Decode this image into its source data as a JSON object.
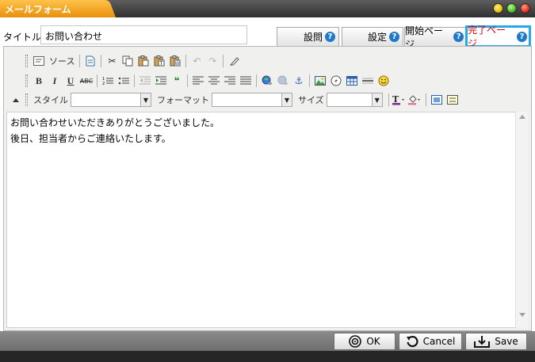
{
  "window": {
    "title": "メールフォーム",
    "controls": [
      "minimize",
      "maximize",
      "close"
    ]
  },
  "form": {
    "title_label": "タイトル:",
    "title_value": "お問い合わせ"
  },
  "tabs": [
    {
      "label": "設問",
      "active": false
    },
    {
      "label": "設定",
      "active": false
    },
    {
      "label": "開始ページ",
      "active": false
    },
    {
      "label": "完了ページ",
      "active": true
    }
  ],
  "help_glyph": "?",
  "toolbar": {
    "source_label": "ソース",
    "style_label": "スタイル",
    "format_label": "フォーマット",
    "size_label": "サイズ",
    "style_value": "",
    "format_value": "",
    "size_value": ""
  },
  "content": {
    "lines": [
      "お問い合わせいただきありがとうございました。",
      "後日、担当者からご連絡いたします。"
    ]
  },
  "buttons": {
    "ok": "OK",
    "cancel": "Cancel",
    "save": "Save"
  },
  "colors": {
    "accent_orange": "#f5a623",
    "active_tab_border": "#27a9e7",
    "active_tab_text": "#d80000",
    "help_icon": "#1f78c8"
  }
}
